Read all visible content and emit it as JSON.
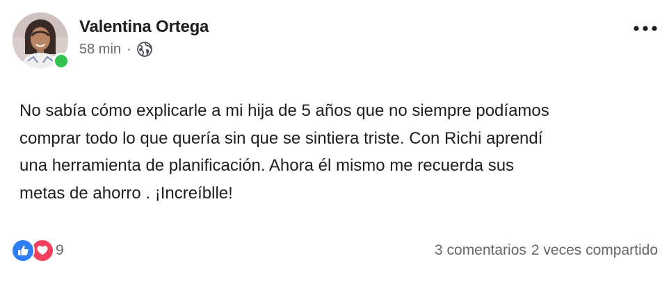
{
  "post": {
    "author": "Valentina Ortega",
    "time": "58 min",
    "separator": "·",
    "audience_icon": "globe-icon",
    "more_icon": "more-options-icon",
    "text": "No sabía cómo explicarle a mi hija de 5 años que no siempre podíamos\ncomprar todo lo que quería sin que se sintiera triste. Con Richi aprendí\nuna herramienta de planificación. Ahora él mismo me recuerda sus\nmetas de ahorro . ¡Increíblle!",
    "online": true
  },
  "footer": {
    "reaction_icons": [
      "like-icon",
      "love-icon"
    ],
    "reaction_count": "9",
    "comments": "3 comentarios",
    "shares": "2 veces compartido"
  },
  "colors": {
    "like": "#2e7ef5",
    "love": "#f0405d",
    "online": "#31c24d",
    "meta_text": "#65676b"
  }
}
